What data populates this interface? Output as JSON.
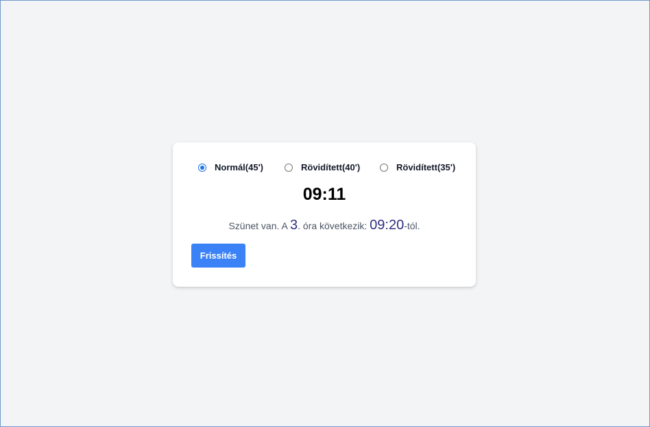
{
  "bell_options": [
    {
      "label": "Normál(45')",
      "checked": true
    },
    {
      "label": "Rövidített(40')",
      "checked": false
    },
    {
      "label": "Rövidített(35')",
      "checked": false
    }
  ],
  "clock": {
    "time": "09:11"
  },
  "status": {
    "prefix": "Szünet van. A ",
    "lesson_number": "3",
    "middle": ". óra következik: ",
    "next_time": "09:20",
    "suffix": "-tól."
  },
  "refresh_button": {
    "label": "Frissítés",
    "color": "#3b82f6"
  },
  "colors": {
    "background": "#f3f4f6",
    "accent": "#1a73e8",
    "highlight_text": "#312e81"
  }
}
